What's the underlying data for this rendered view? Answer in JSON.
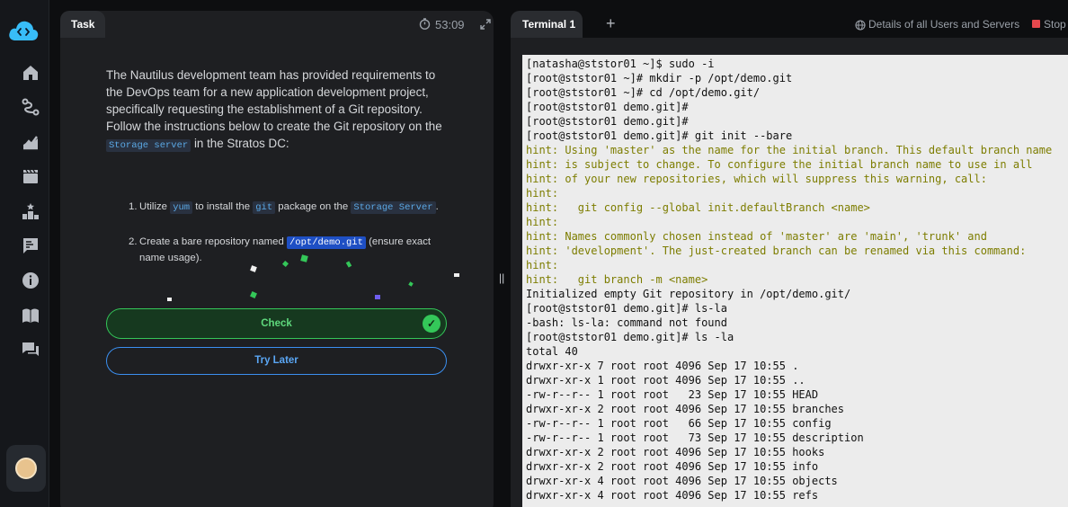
{
  "task_panel": {
    "tab_label": "Task",
    "timer": "53:09",
    "intro_before": "The Nautilus development team has provided requirements to the DevOps team for a new application development project, specifically requesting the establishment of a Git repository. Follow the instructions below to create the Git repository on the ",
    "intro_code": "Storage server",
    "intro_after": " in the Stratos DC:",
    "step1": {
      "num": "1.",
      "t1": "Utilize ",
      "c1": "yum",
      "t2": " to install the ",
      "c2": "git",
      "t3": " package on the ",
      "c3": "Storage Server",
      "t4": "."
    },
    "step2": {
      "num": "2.",
      "t1": "Create a bare repository named ",
      "c1": "/opt/demo.git",
      "t2": " (ensure exact name usage)."
    },
    "check_label": "Check",
    "try_later_label": "Try Later"
  },
  "terminal_panel": {
    "tab_label": "Terminal 1",
    "add_tab": "+",
    "details_link": "Details of all Users and Servers",
    "stop_label": "Stop"
  },
  "terminal_lines": [
    {
      "text": "[natasha@ststor01 ~]$ sudo -i",
      "kind": "cmd"
    },
    {
      "text": "[root@ststor01 ~]# mkdir -p /opt/demo.git",
      "kind": "cmd"
    },
    {
      "text": "[root@ststor01 ~]# cd /opt/demo.git/",
      "kind": "cmd"
    },
    {
      "text": "[root@ststor01 demo.git]#",
      "kind": "cmd"
    },
    {
      "text": "[root@ststor01 demo.git]#",
      "kind": "cmd"
    },
    {
      "text": "[root@ststor01 demo.git]# git init --bare",
      "kind": "cmd"
    },
    {
      "text": "hint: Using 'master' as the name for the initial branch. This default branch name",
      "kind": "hint"
    },
    {
      "text": "hint: is subject to change. To configure the initial branch name to use in all",
      "kind": "hint"
    },
    {
      "text": "hint: of your new repositories, which will suppress this warning, call:",
      "kind": "hint"
    },
    {
      "text": "hint:",
      "kind": "hint"
    },
    {
      "text": "hint:   git config --global init.defaultBranch <name>",
      "kind": "hint"
    },
    {
      "text": "hint:",
      "kind": "hint"
    },
    {
      "text": "hint: Names commonly chosen instead of 'master' are 'main', 'trunk' and",
      "kind": "hint"
    },
    {
      "text": "hint: 'development'. The just-created branch can be renamed via this command:",
      "kind": "hint"
    },
    {
      "text": "hint:",
      "kind": "hint"
    },
    {
      "text": "hint:   git branch -m <name>",
      "kind": "hint"
    },
    {
      "text": "Initialized empty Git repository in /opt/demo.git/",
      "kind": "out"
    },
    {
      "text": "[root@ststor01 demo.git]# ls-la",
      "kind": "cmd"
    },
    {
      "text": "-bash: ls-la: command not found",
      "kind": "out"
    },
    {
      "text": "[root@ststor01 demo.git]# ls -la",
      "kind": "cmd"
    },
    {
      "text": "total 40",
      "kind": "out"
    },
    {
      "text": "drwxr-xr-x 7 root root 4096 Sep 17 10:55 .",
      "kind": "out"
    },
    {
      "text": "drwxr-xr-x 1 root root 4096 Sep 17 10:55 ..",
      "kind": "out"
    },
    {
      "text": "-rw-r--r-- 1 root root   23 Sep 17 10:55 HEAD",
      "kind": "out"
    },
    {
      "text": "drwxr-xr-x 2 root root 4096 Sep 17 10:55 branches",
      "kind": "out"
    },
    {
      "text": "-rw-r--r-- 1 root root   66 Sep 17 10:55 config",
      "kind": "out"
    },
    {
      "text": "-rw-r--r-- 1 root root   73 Sep 17 10:55 description",
      "kind": "out"
    },
    {
      "text": "drwxr-xr-x 2 root root 4096 Sep 17 10:55 hooks",
      "kind": "out"
    },
    {
      "text": "drwxr-xr-x 2 root root 4096 Sep 17 10:55 info",
      "kind": "out"
    },
    {
      "text": "drwxr-xr-x 4 root root 4096 Sep 17 10:55 objects",
      "kind": "out"
    },
    {
      "text": "drwxr-xr-x 4 root root 4096 Sep 17 10:55 refs",
      "kind": "out"
    }
  ],
  "sidebar_icons": [
    "logo-cloud-icon",
    "home-icon",
    "path-icon",
    "chart-icon",
    "clapper-icon",
    "leaderboard-icon",
    "feedback-icon",
    "info-icon",
    "book-icon",
    "chat-icon"
  ],
  "colors": {
    "accent_green": "#34c759",
    "accent_blue": "#3b8ff0",
    "hint_text": "#7d7d00",
    "stop_red": "#e5484d"
  }
}
